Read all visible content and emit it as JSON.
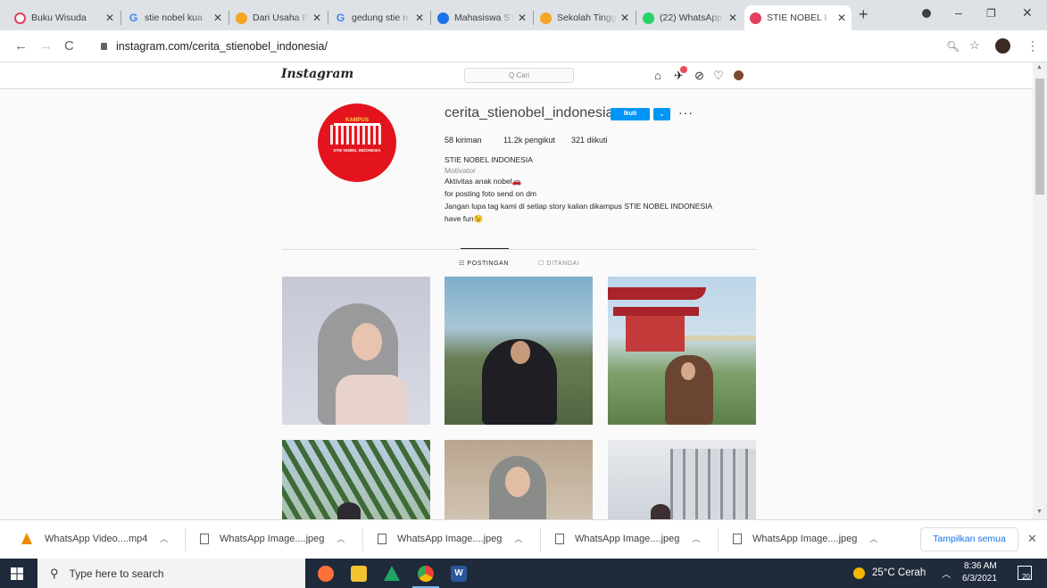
{
  "browser": {
    "tabs": [
      {
        "title": "Buku Wisuda",
        "icon": "tab-favicon",
        "color": "#e4405f"
      },
      {
        "title": "stie nobel kua",
        "icon": "google-icon",
        "color": "#4285f4"
      },
      {
        "title": "Dari Usaha Pe",
        "icon": "tab-favicon",
        "color": "#f5a623"
      },
      {
        "title": "gedung stie n",
        "icon": "google-icon",
        "color": "#4285f4"
      },
      {
        "title": "Mahasiswa ST",
        "icon": "tab-favicon",
        "color": "#1a73e8"
      },
      {
        "title": "Sekolah Tingg",
        "icon": "tab-favicon",
        "color": "#f5a623"
      },
      {
        "title": "(22) WhatsApp",
        "icon": "whatsapp-icon",
        "color": "#25d366"
      },
      {
        "title": "STIE NOBEL I",
        "icon": "instagram-icon",
        "color": "#e4405f"
      }
    ],
    "url": "instagram.com/cerita_stienobel_indonesia/"
  },
  "instagram": {
    "logo": "Instagram",
    "search_placeholder": "Q Cari",
    "notification_count": "",
    "username": "cerita_stienobel_indonesia",
    "follow_label": "Ikuti",
    "more_label": "···",
    "stats": {
      "posts": "58 kiriman",
      "followers": "11.2k pengikut",
      "following": "321 diikuti"
    },
    "bio": {
      "name": "STIE NOBEL INDONESIA",
      "category": "Motivator",
      "line1": "Aktivitas anak nobel🚗",
      "line2": "for posting foto send on dm",
      "line3": "Jangan lupa tag kami di setiap story kalian dikampus STIE NOBEL INDONESIA",
      "line4": "have fun😉"
    },
    "avatar": {
      "top": "KAMPUS",
      "bottom": "STIE NOBEL INDONESIA"
    },
    "tabs": {
      "posts": "☷ POSTINGAN",
      "tagged": "☐ DITANDAI"
    },
    "photos": [
      {
        "bg": "#c9ccd8"
      },
      {
        "bg": "#7aa6c4"
      },
      {
        "bg": "#b9d3e6"
      },
      {
        "bg": "#b8cfe2"
      },
      {
        "bg": "#d9d5cc"
      },
      {
        "bg": "#e6e8ec"
      }
    ]
  },
  "downloads": {
    "items": [
      {
        "name": "WhatsApp Video....mp4"
      },
      {
        "name": "WhatsApp Image....jpeg"
      },
      {
        "name": "WhatsApp Image....jpeg"
      },
      {
        "name": "WhatsApp Image....jpeg"
      },
      {
        "name": "WhatsApp Image....jpeg"
      }
    ],
    "show_all": "Tampilkan semua"
  },
  "taskbar": {
    "search_placeholder": "Type here to search",
    "weather": "25°C Cerah",
    "time": "8:36 AM",
    "date": "6/3/2021",
    "notifications": "20"
  }
}
